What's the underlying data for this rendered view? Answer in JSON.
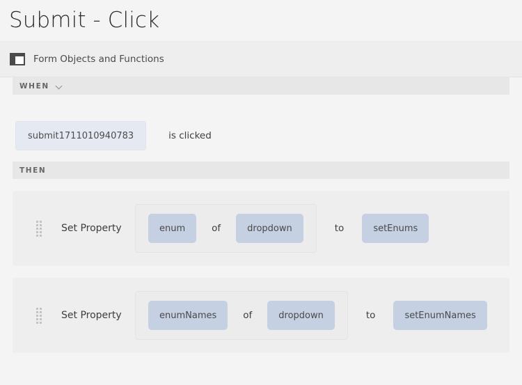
{
  "header": {
    "title": "Submit - Click"
  },
  "context": {
    "icon": "form-layout-icon",
    "label": "Form Objects and Functions"
  },
  "when_section": {
    "strip_label": "WHEN",
    "chevron_icon": "chevron-down-icon",
    "trigger": "submit1711010940783",
    "verb": "is clicked"
  },
  "then_section": {
    "strip_label": "THEN",
    "actions": [
      {
        "drag_handle_icon": "drag-handle-icon",
        "label": "Set Property",
        "property_token": "enum",
        "of_label": "of",
        "target_token": "dropdown",
        "to_label": "to",
        "value_token": "setEnums"
      },
      {
        "drag_handle_icon": "drag-handle-icon",
        "label": "Set Property",
        "property_token": "enumNames",
        "of_label": "of",
        "target_token": "dropdown",
        "to_label": "to",
        "value_token": "setEnumNames"
      }
    ]
  },
  "colors": {
    "page_background": "#f4f4f4",
    "band_background": "#eeeeee",
    "strip_background": "#e7e7e7",
    "token_blue": "#c5d0e3",
    "trigger_blue": "#e5eaf2",
    "text": "#3b3b3b"
  }
}
